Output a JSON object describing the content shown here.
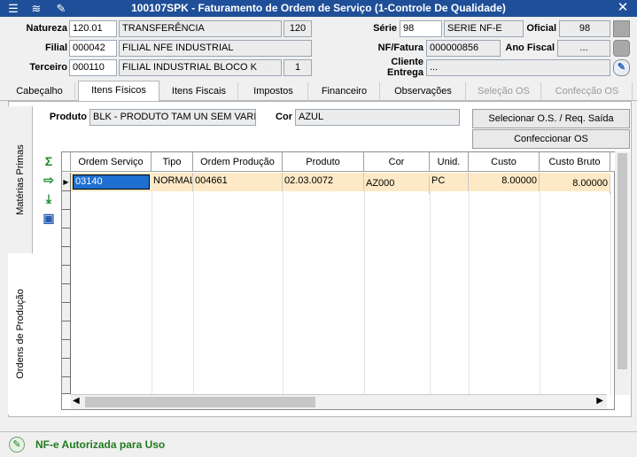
{
  "window": {
    "title": "100107SPK - Faturamento de Ordem de Serviço (1-Controle De Qualidade)",
    "close": "✕"
  },
  "header": {
    "natureza": {
      "label": "Natureza",
      "code": "120.01",
      "desc": "TRANSFERÊNCIA",
      "num": "120"
    },
    "filial": {
      "label": "Filial",
      "code": "000042",
      "desc": "FILIAL NFE INDUSTRIAL"
    },
    "terceiro": {
      "label": "Terceiro",
      "code": "000110",
      "desc": "FILIAL INDUSTRIAL BLOCO K",
      "num": "1"
    },
    "serie": {
      "label": "Série",
      "code": "98",
      "desc": "SERIE NF-E"
    },
    "oficial": {
      "label": "Oficial",
      "value": "98"
    },
    "nf_fatura": {
      "label": "NF/Fatura",
      "value": "000000856"
    },
    "ano_fiscal": {
      "label": "Ano Fiscal",
      "value": "..."
    },
    "cliente_entrega": {
      "label1": "Cliente",
      "label2": "Entrega",
      "value": "..."
    }
  },
  "tabs": [
    "Cabeçalho",
    "Itens Físicos",
    "Itens Fiscais",
    "Impostos",
    "Financeiro",
    "Observações",
    "Seleção OS",
    "Confecção OS"
  ],
  "side_tabs": [
    "Matérias Primas",
    "Ordens de Produção"
  ],
  "product": {
    "label": "Produto",
    "value": "BLK - PRODUTO TAM UN SEM VARIA C",
    "cor_label": "Cor",
    "cor_value": "AZUL"
  },
  "buttons": {
    "select_os": "Selecionar O.S. / Req. Saída",
    "confeccionar": "Confeccionar OS"
  },
  "grid": {
    "columns": [
      "Ordem Serviço",
      "Tipo",
      "Ordem Produção",
      "Produto",
      "Cor",
      "Unid.",
      "Custo",
      "Custo Bruto"
    ],
    "rows": [
      [
        "03140",
        "NORMAL",
        "004661",
        "02.03.0072",
        "AZ000",
        "PC",
        "8.00000",
        "8.00000"
      ]
    ]
  },
  "side_icons": [
    "sigma-icon",
    "export-icon",
    "download-icon",
    "image-icon"
  ],
  "status": {
    "text": "NF-e Autorizada para Uso"
  },
  "colors": {
    "title_bg": "#1f4f98",
    "selected_row": "#fde9c5",
    "status_text": "#1f7a1f"
  }
}
